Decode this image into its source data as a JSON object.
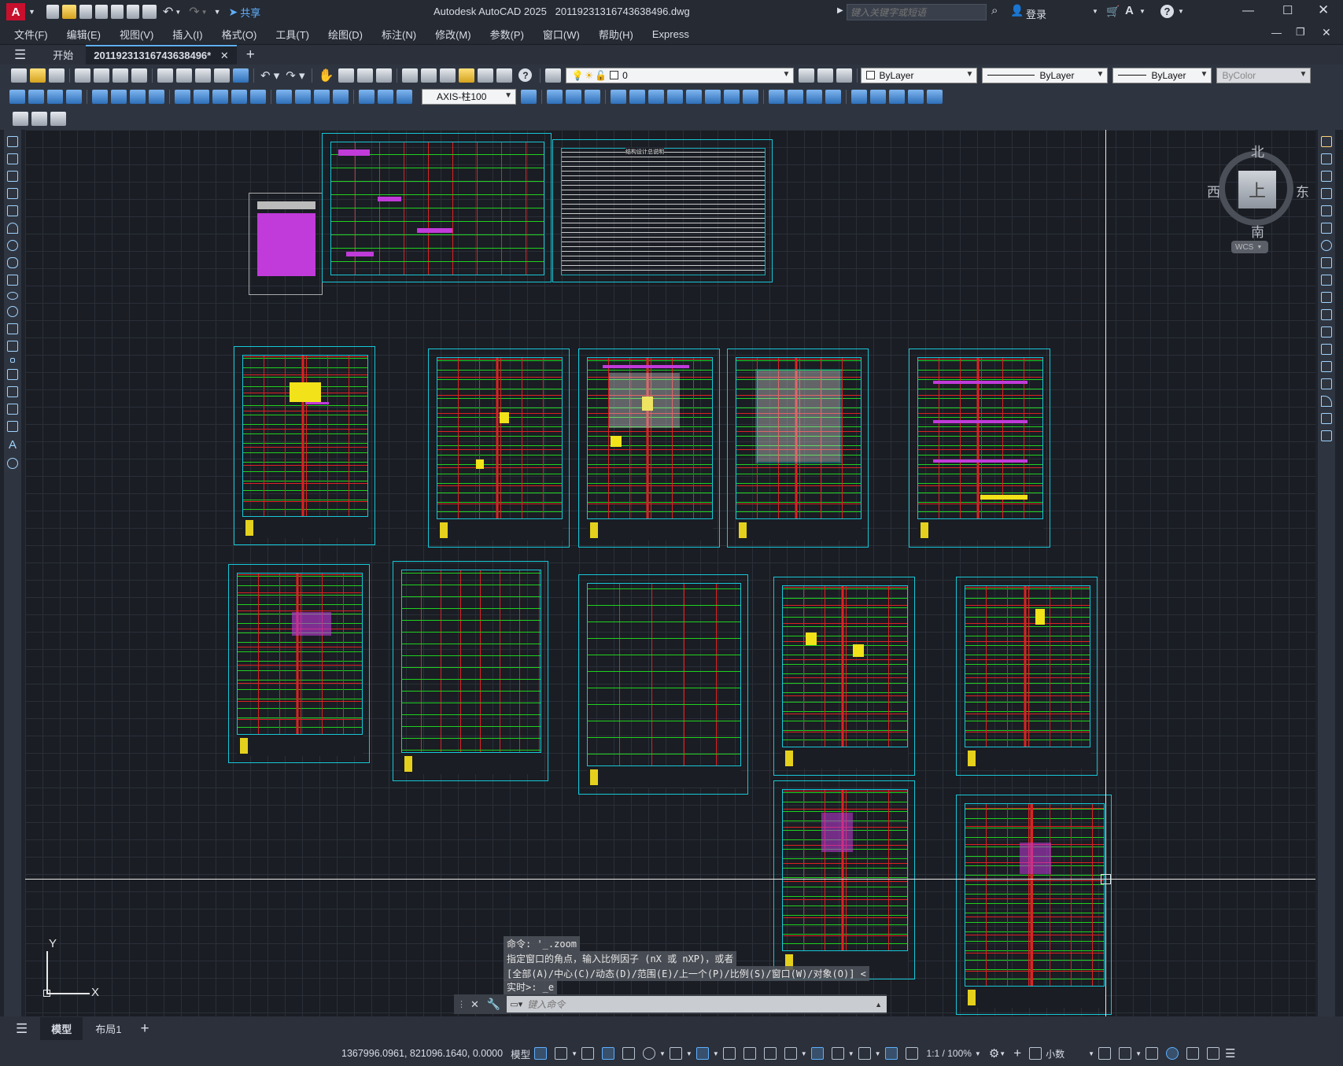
{
  "app": {
    "title": "Autodesk AutoCAD 2025",
    "filename": "20119231316743638496.dwg",
    "logo": "A",
    "share": "共享",
    "search_placeholder": "键入关键字或短语",
    "login": "登录"
  },
  "menu": [
    "文件(F)",
    "编辑(E)",
    "视图(V)",
    "插入(I)",
    "格式(O)",
    "工具(T)",
    "绘图(D)",
    "标注(N)",
    "修改(M)",
    "参数(P)",
    "窗口(W)",
    "帮助(H)",
    "Express"
  ],
  "tabs": {
    "start": "开始",
    "doc": "20119231316743638496*",
    "add": "+"
  },
  "properties": {
    "layer": "0",
    "color": "ByLayer",
    "linetype": "ByLayer",
    "lineweight": "ByLayer",
    "plotstyle": "ByColor",
    "dimstyle": "AXIS-柱100"
  },
  "viewcube": {
    "north": "北",
    "south": "南",
    "east": "东",
    "west": "西",
    "top": "上",
    "wcs": "WCS"
  },
  "ucs": {
    "x": "X",
    "y": "Y"
  },
  "command": {
    "history": [
      "命令: '_.zoom",
      "指定窗口的角点，输入比例因子 (nX 或 nXP)，或者",
      "[全部(A)/中心(C)/动态(D)/范围(E)/上一个(P)/比例(S)/窗口(W)/对象(O)] <",
      "实时>: _e"
    ],
    "placeholder": "键入命令"
  },
  "layouts": [
    "模型",
    "布局1"
  ],
  "status": {
    "coords": "1367996.0961, 821096.1640, 0.0000",
    "space": "模型",
    "scale": "1:1 / 100%",
    "units": "小数"
  },
  "sheet_titles": {
    "notes": "结构设计总说明"
  },
  "colors": {
    "cyan": "#17c7d9",
    "green": "#1fd11f",
    "red": "#dd2222",
    "yellow": "#f1e21a",
    "magenta": "#c03bd9",
    "background": "#1a1d23"
  }
}
